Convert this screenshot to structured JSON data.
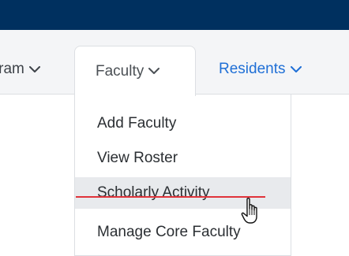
{
  "nav": {
    "program_label": "Program",
    "faculty_label": "Faculty",
    "residents_label": "Residents"
  },
  "faculty_menu": {
    "items": [
      {
        "label": "Add Faculty"
      },
      {
        "label": "View Roster"
      },
      {
        "label": "Scholarly Activity"
      },
      {
        "label": "Manage Core Faculty"
      }
    ]
  },
  "colors": {
    "header_bar": "#00305f",
    "link_blue": "#1f6fd6",
    "strike_red": "#e0333a",
    "hover_bg": "#e8eaed"
  },
  "icons": {
    "chevron": "chevron-down-icon",
    "cursor": "hand-pointer-icon"
  }
}
